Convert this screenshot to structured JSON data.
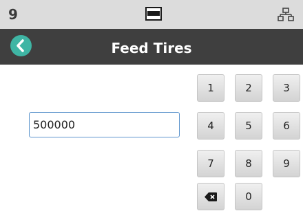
{
  "status_bar": {
    "number": "9",
    "battery_icon": "battery-icon",
    "network_icon": "network-icon"
  },
  "title_bar": {
    "back_icon": "chevron-left-icon",
    "title": "Feed Tires"
  },
  "input": {
    "value": "500000"
  },
  "keypad": {
    "keys": [
      "1",
      "2",
      "3",
      "4",
      "5",
      "6",
      "7",
      "8",
      "9",
      "0"
    ],
    "backspace_icon": "backspace-icon"
  },
  "colors": {
    "accent": "#3fb5a4",
    "title_bar": "#3f3f3f",
    "status_bar": "#dcdcdc",
    "input_border": "#5b93cc"
  }
}
